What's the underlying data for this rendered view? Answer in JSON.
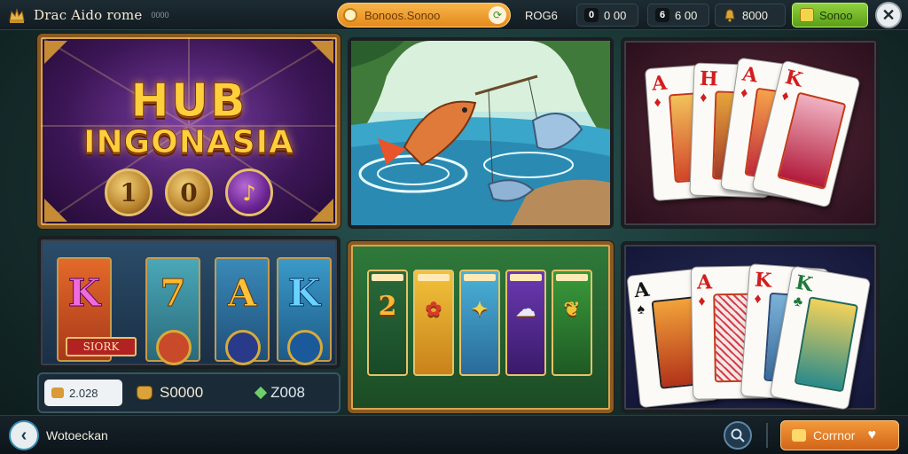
{
  "header": {
    "brand_title": "Drac Aido rome",
    "brand_sub": "0000",
    "search_placeholder": "Bonoos.Sonoo",
    "stat_a": "ROG6",
    "stat_b": "0 00",
    "stat_b_badge": "",
    "stat_c": "6 00",
    "stat_d": "8000",
    "green_button": "Sonoo",
    "close_glyph": "✕"
  },
  "tiles": {
    "hub": {
      "line1": "HUB",
      "line2": "INGONASIA",
      "coins": [
        "1",
        "0",
        "♪"
      ]
    },
    "fishing": {},
    "cards_top": {
      "cards": [
        {
          "rank": "A",
          "suit": "♦"
        },
        {
          "rank": "H",
          "suit": "♦"
        },
        {
          "rank": "A",
          "suit": "♦"
        },
        {
          "rank": "K",
          "suit": "♦"
        }
      ]
    },
    "slots": {
      "reels": [
        "K",
        "7",
        "A",
        "K"
      ],
      "reel_label": "SIORK"
    },
    "mini_slots": {
      "numbers": [
        "2",
        "",
        "",
        "",
        ""
      ]
    },
    "cards_bottom": {
      "cards": [
        {
          "rank": "A",
          "suit": "♠"
        },
        {
          "rank": "A",
          "suit": "♦"
        },
        {
          "rank": "K",
          "suit": "♦"
        },
        {
          "rank": "K",
          "suit": "♣"
        }
      ]
    }
  },
  "balance_panel": {
    "pill": "2.028",
    "coins": "S0000",
    "gems": "Z008"
  },
  "footer": {
    "back_label": "Wotoeckan",
    "cta_label": "Corrnor"
  },
  "colors": {
    "accent_orange": "#e48a1c",
    "accent_green": "#5a9e19",
    "gold_frame": "#8a5a22"
  }
}
